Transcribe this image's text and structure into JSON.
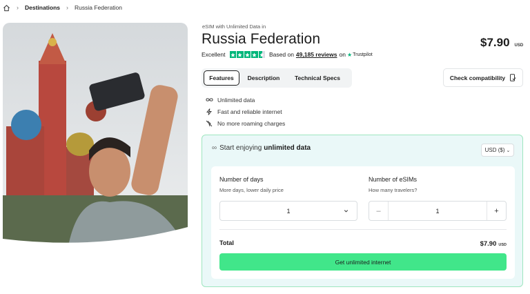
{
  "breadcrumb": {
    "home_icon": "home-icon",
    "destinations": "Destinations",
    "current": "Russia Federation"
  },
  "product": {
    "subtitle": "eSIM with Unlimited Data in",
    "title": "Russia Federation",
    "price": "$7.90",
    "currency": "USD"
  },
  "rating": {
    "label": "Excellent",
    "stars": 4.5,
    "based_on": "Based on",
    "reviews": "49,185 reviews",
    "on": "on",
    "provider": "Trustpilot"
  },
  "tabs": [
    {
      "label": "Features",
      "active": true
    },
    {
      "label": "Description",
      "active": false
    },
    {
      "label": "Technical Specs",
      "active": false
    }
  ],
  "compatibility": {
    "label": "Check compatibility",
    "icon": "phone-check-icon"
  },
  "features": [
    {
      "icon": "infinity-icon",
      "label": "Unlimited data"
    },
    {
      "icon": "lightning-icon",
      "label": "Fast and reliable internet"
    },
    {
      "icon": "no-roaming-icon",
      "label": "No more roaming charges"
    }
  ],
  "purchase": {
    "heading_prefix": "Start enjoying",
    "heading_bold": "unlimited data",
    "currency_select": "USD ($)",
    "days": {
      "label": "Number of days",
      "hint": "More days, lower daily price",
      "value": "1"
    },
    "esims": {
      "label": "Number of eSIMs",
      "hint": "How many travelers?",
      "value": "1",
      "minus": "–",
      "plus": "+"
    },
    "total_label": "Total",
    "total_price": "$7.90",
    "total_currency": "USD",
    "cta": "Get unlimited internet"
  },
  "colors": {
    "accent_green": "#41e68a",
    "trustpilot_green": "#00b67a",
    "box_bg": "#eaf8f8"
  }
}
